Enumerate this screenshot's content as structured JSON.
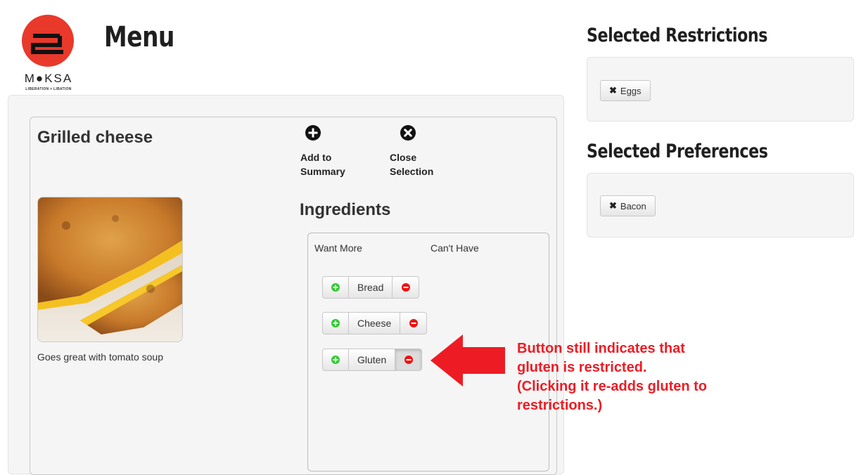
{
  "brand": {
    "name": "M●KSA",
    "tagline": "LIBERATION + LIBATION"
  },
  "page": {
    "title": "Menu"
  },
  "dish": {
    "name": "Grilled cheese",
    "description": "Goes great with tomato soup",
    "image_alt": "Grilled cheese sandwich"
  },
  "actions": {
    "add_label": "Add to\nSummary",
    "close_label": "Close\nSelection"
  },
  "ingredients": {
    "title": "Ingredients",
    "col_want_more": "Want More",
    "col_cant_have": "Can't Have",
    "items": [
      {
        "name": "Bread",
        "restricted": false
      },
      {
        "name": "Cheese",
        "restricted": false
      },
      {
        "name": "Gluten",
        "restricted": true
      }
    ]
  },
  "restrictions": {
    "title": "Selected Restrictions",
    "items": [
      "Eggs"
    ]
  },
  "preferences": {
    "title": "Selected Preferences",
    "items": [
      "Bacon"
    ]
  },
  "annotation": {
    "text": "Button still indicates that\ngluten is restricted.\n(Clicking it re-adds gluten to\nrestrictions.)",
    "color": "#ed1c24"
  },
  "colors": {
    "plus": "#2ecc2e",
    "minus": "#ee1111",
    "brand_red": "#e8392b"
  }
}
